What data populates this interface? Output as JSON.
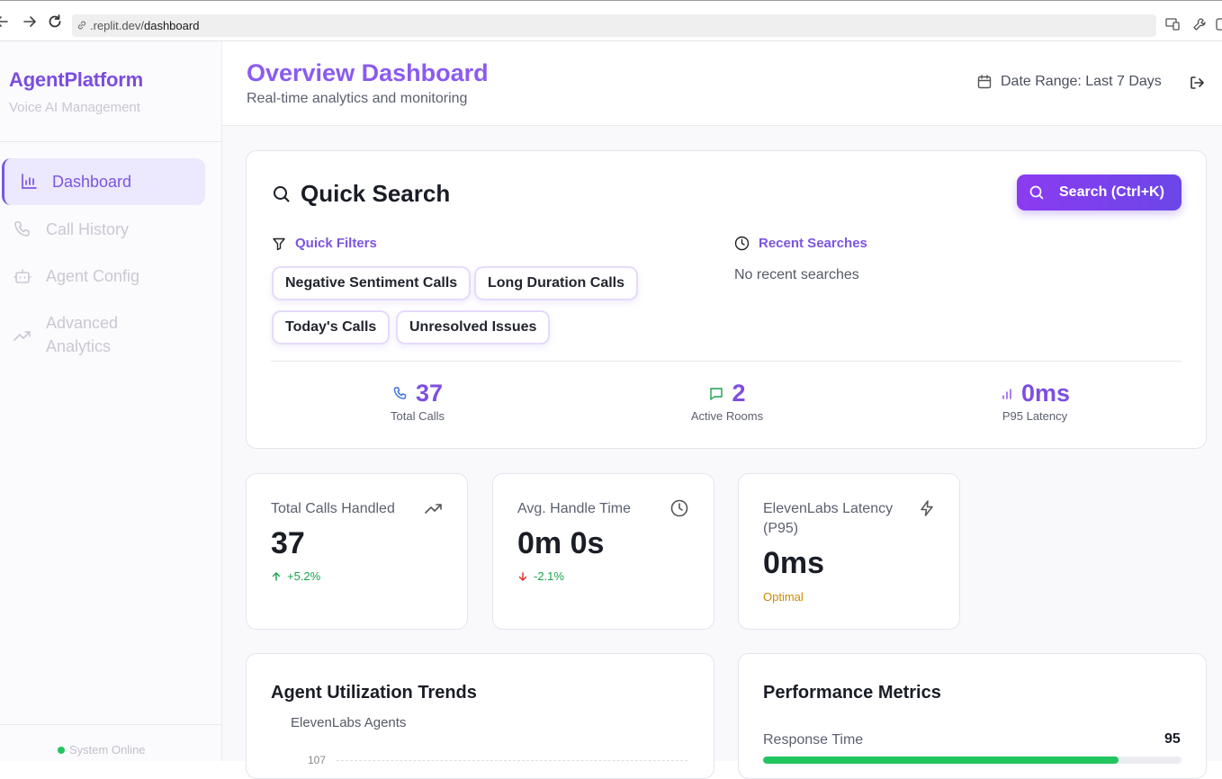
{
  "browser": {
    "url_host": ".replit.dev/",
    "url_path": "dashboard"
  },
  "sidebar": {
    "brand": "AgentPlatform",
    "brand_sub": "Voice AI Management",
    "items": [
      {
        "label": "Dashboard",
        "icon": "bar-chart-icon",
        "active": true
      },
      {
        "label": "Call History",
        "icon": "phone-icon",
        "active": false
      },
      {
        "label": "Agent Config",
        "icon": "bot-icon",
        "active": false
      },
      {
        "label": "Advanced Analytics",
        "label_line1": "Advanced",
        "label_line2": "Analytics",
        "icon": "trending-up-icon",
        "active": false
      }
    ],
    "status": "System Online",
    "status_color": "#22c55e"
  },
  "header": {
    "title": "Overview Dashboard",
    "subtitle": "Real-time analytics and monitoring",
    "date_range": "Date Range: Last 7 Days"
  },
  "quick_search": {
    "title": "Quick Search",
    "button_label": "Search (Ctrl+K)",
    "filters_title": "Quick Filters",
    "filters": [
      "Negative Sentiment Calls",
      "Long Duration Calls",
      "Today's Calls",
      "Unresolved Issues"
    ],
    "recent_title": "Recent Searches",
    "recent_empty": "No recent searches",
    "stats": [
      {
        "value": "37",
        "label": "Total Calls",
        "icon": "phone-icon"
      },
      {
        "value": "2",
        "label": "Active Rooms",
        "icon": "message-icon"
      },
      {
        "value": "0ms",
        "label": "P95 Latency",
        "icon": "signal-icon"
      }
    ]
  },
  "metrics": [
    {
      "label": "Total Calls Handled",
      "value": "37",
      "change": "+5.2%",
      "trend": "up",
      "icon": "trending-up-icon"
    },
    {
      "label": "Avg. Handle Time",
      "value": "0m 0s",
      "change": "-2.1%",
      "trend": "down",
      "icon": "clock-icon"
    },
    {
      "label_line1": "ElevenLabs Latency",
      "label_line2": "(P95)",
      "value": "0ms",
      "status": "Optimal",
      "icon": "zap-icon"
    }
  ],
  "utilization": {
    "title": "Agent Utilization Trends",
    "legend": "ElevenLabs Agents",
    "tick": "107"
  },
  "performance": {
    "title": "Performance Metrics",
    "rows": [
      {
        "label": "Response Time",
        "value": "95",
        "fraction": 0.85
      }
    ]
  },
  "colors": {
    "accent": "#7c55e0",
    "positive": "#16a34a",
    "negative": "#dc2626",
    "warning": "#ca8a04"
  }
}
